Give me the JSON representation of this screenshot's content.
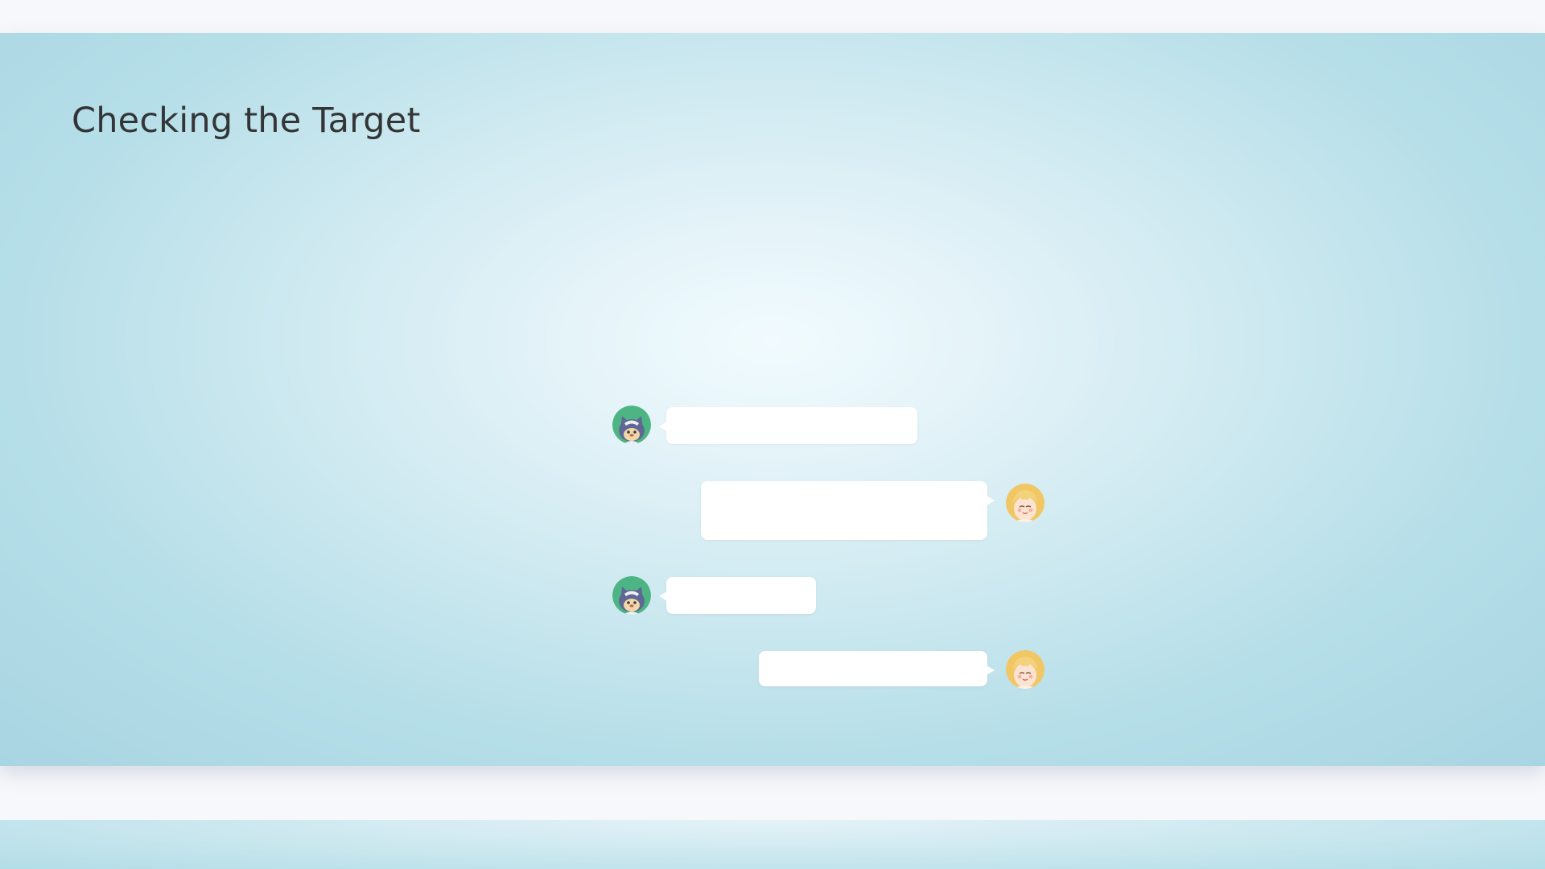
{
  "slide": {
    "title": "Checking the Target"
  },
  "conversation": {
    "messages": [
      {
        "speaker_icon": "cat-ninja-avatar-icon",
        "side": "left",
        "text": ""
      },
      {
        "speaker_icon": "girl-blonde-avatar-icon",
        "side": "right",
        "text": ""
      },
      {
        "speaker_icon": "cat-ninja-avatar-icon",
        "side": "left",
        "text": ""
      },
      {
        "speaker_icon": "girl-blonde-avatar-icon",
        "side": "right",
        "text": ""
      }
    ]
  },
  "colors": {
    "slide_background": "#a8d5e2",
    "slide_center_glow": "#f1fbfe",
    "page_background": "#f7f8fc",
    "title_text": "#333536",
    "bubble": "#ffffff",
    "cat_avatar_ring": "#4db583",
    "cat_avatar_fur": "#5f6894",
    "girl_avatar_hair": "#f0c764",
    "girl_avatar_face": "#fae3d0"
  }
}
